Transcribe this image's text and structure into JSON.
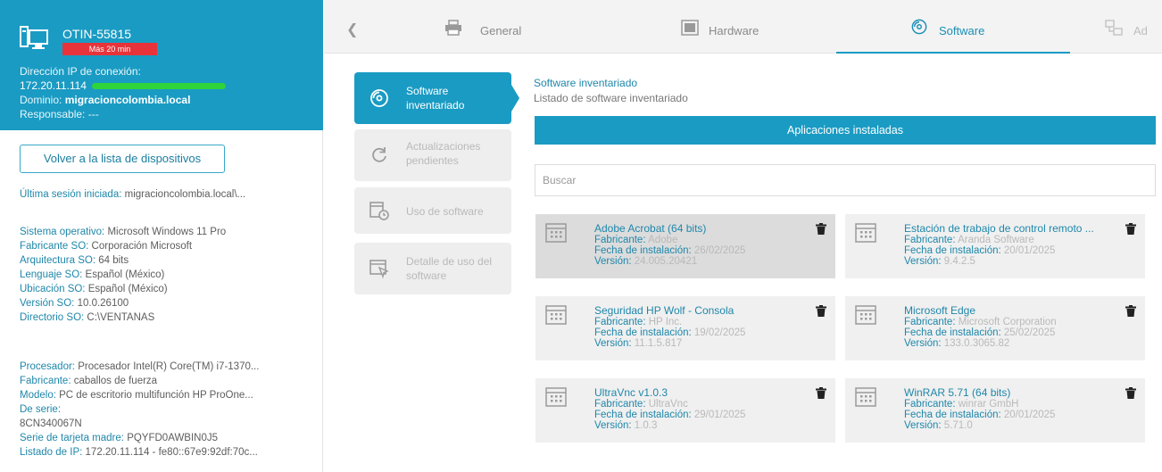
{
  "device": {
    "name": "OTIN-55815",
    "badge": "Más 20 min",
    "ip_label": "Dirección IP de conexión:",
    "ip": "172.20.11.114",
    "domain_label": "Dominio:",
    "domain": "migracioncolombia.local",
    "responsible": "Responsable: ---"
  },
  "back_button": "Volver a la lista de dispositivos",
  "info_groups": [
    [
      {
        "k": "Última sesión iniciada:",
        "v": "migracioncolombia.local\\..."
      }
    ],
    [
      {
        "k": "Sistema operativo:",
        "v": "Microsoft Windows 11 Pro"
      },
      {
        "k": "Fabricante SO:",
        "v": "Corporación Microsoft"
      },
      {
        "k": "Arquitectura SO:",
        "v": "64 bits"
      },
      {
        "k": "Lenguaje SO:",
        "v": "Español (México)"
      },
      {
        "k": "Ubicación SO:",
        "v": "Español (México)"
      },
      {
        "k": "Versión SO:",
        "v": "10.0.26100"
      },
      {
        "k": "Directorio SO:",
        "v": "C:\\VENTANAS"
      }
    ],
    [
      {
        "k": "Procesador:",
        "v": "Procesador Intel(R) Core(TM) i7-1370..."
      },
      {
        "k": "Fabricante:",
        "v": "caballos de fuerza"
      },
      {
        "k": "Modelo:",
        "v": "PC de escritorio multifunción HP ProOne..."
      },
      {
        "k": "De serie:",
        "v": ""
      },
      {
        "k": "",
        "v": "8CN340067N"
      },
      {
        "k": "Serie de tarjeta madre:",
        "v": "PQYFD0AWBIN0J5"
      },
      {
        "k": "Listado de IP:",
        "v": "172.20.11.114 - fe80::67e9:92df:70c..."
      }
    ]
  ],
  "tabs": [
    {
      "label": "General",
      "icon": "printer-icon"
    },
    {
      "label": "Hardware",
      "icon": "monitor-icon"
    },
    {
      "label": "Software",
      "icon": "software-disc-icon",
      "active": true
    },
    {
      "label": "Ad",
      "icon": "network-icon"
    }
  ],
  "steps": [
    {
      "label": "Software inventariado",
      "icon": "software-disc-icon",
      "active": true
    },
    {
      "label": "Actualizaciones pendientes",
      "icon": "refresh-icon"
    },
    {
      "label": "Uso de software",
      "icon": "window-clock-icon"
    },
    {
      "label": "Detalle de uso del software",
      "icon": "window-cursor-icon"
    }
  ],
  "content": {
    "title": "Software inventariado",
    "subtitle": "Listado de software inventariado",
    "section_header": "Aplicaciones instaladas",
    "search_placeholder": "Buscar"
  },
  "labels": {
    "manufacturer": "Fabricante:",
    "install_date": "Fecha de instalación:",
    "version": "Versión:"
  },
  "apps": [
    {
      "name": "Adobe Acrobat (64 bits)",
      "manufacturer": "Adobe",
      "install_date": "26/02/2025",
      "version": "24.005.20421",
      "selected": true
    },
    {
      "name": "Estación de trabajo de control remoto ...",
      "manufacturer": "Aranda Software",
      "install_date": "20/01/2025",
      "version": "9.4.2.5"
    },
    {
      "name": "Seguridad HP Wolf - Consola",
      "manufacturer": "HP Inc.",
      "install_date": "19/02/2025",
      "version": "11.1.5.817"
    },
    {
      "name": "Microsoft Edge",
      "manufacturer": "Microsoft Corporation",
      "install_date": "25/02/2025",
      "version": "133.0.3065.82"
    },
    {
      "name": "UltraVnc v1.0.3",
      "manufacturer": "UltraVnc",
      "install_date": "29/01/2025",
      "version": "1.0.3"
    },
    {
      "name": "WinRAR 5.71 (64 bits)",
      "manufacturer": "winrar GmbH",
      "install_date": "20/01/2025",
      "version": "5.71.0"
    }
  ],
  "colors": {
    "accent": "#1a9bc3",
    "badge": "#e8333a",
    "ip_bar": "#2fd33a"
  }
}
